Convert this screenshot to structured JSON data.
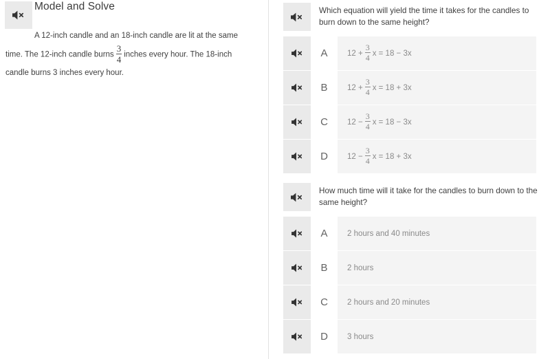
{
  "lesson": {
    "title": "Model and Solve",
    "speaker_icon": "speaker-mute-icon",
    "passage": {
      "before_fraction": "A 12-inch candle and an 18-inch candle are lit at the same time. The 12-inch candle burns",
      "fraction": {
        "numerator": "3",
        "denominator": "4"
      },
      "after_fraction": "inches every hour. The 18-inch candle burns 3 inches every hour."
    }
  },
  "questions": [
    {
      "speaker_icon": "speaker-mute-icon",
      "prompt": "Which equation will yield the time it takes for the candles to burn down to the same height?",
      "options": [
        {
          "letter": "A",
          "speaker_icon": "speaker-mute-icon",
          "text": "12 + 3/4x = 18 − 3x",
          "lhs_before": "12 +",
          "fraction": {
            "numerator": "3",
            "denominator": "4"
          },
          "lhs_after": "x = 18 − 3x"
        },
        {
          "letter": "B",
          "speaker_icon": "speaker-mute-icon",
          "text": "12 + 3/4x = 18 + 3x",
          "lhs_before": "12 +",
          "fraction": {
            "numerator": "3",
            "denominator": "4"
          },
          "lhs_after": "x = 18 + 3x"
        },
        {
          "letter": "C",
          "speaker_icon": "speaker-mute-icon",
          "text": "12 − 3/4x = 18 − 3x",
          "lhs_before": "12 −",
          "fraction": {
            "numerator": "3",
            "denominator": "4"
          },
          "lhs_after": "x = 18 − 3x"
        },
        {
          "letter": "D",
          "speaker_icon": "speaker-mute-icon",
          "text": "12 − 3/4x = 18 + 3x",
          "lhs_before": "12 −",
          "fraction": {
            "numerator": "3",
            "denominator": "4"
          },
          "lhs_after": "x = 18 + 3x"
        }
      ]
    },
    {
      "speaker_icon": "speaker-mute-icon",
      "prompt": "How much time will it take for the candles to burn down to the same height?",
      "options": [
        {
          "letter": "A",
          "speaker_icon": "speaker-mute-icon",
          "text": "2 hours and 40 minutes"
        },
        {
          "letter": "B",
          "speaker_icon": "speaker-mute-icon",
          "text": "2 hours"
        },
        {
          "letter": "C",
          "speaker_icon": "speaker-mute-icon",
          "text": "2 hours and 20 minutes"
        },
        {
          "letter": "D",
          "speaker_icon": "speaker-mute-icon",
          "text": "3 hours"
        }
      ]
    }
  ],
  "colors": {
    "speaker_cell_bg": "#eaeaea",
    "option_bg": "#f4f4f4",
    "letter_bg": "#ffffff",
    "divider": "#e2e2e2",
    "body_text": "#3f3f3f",
    "option_text": "#8a8a8a"
  }
}
